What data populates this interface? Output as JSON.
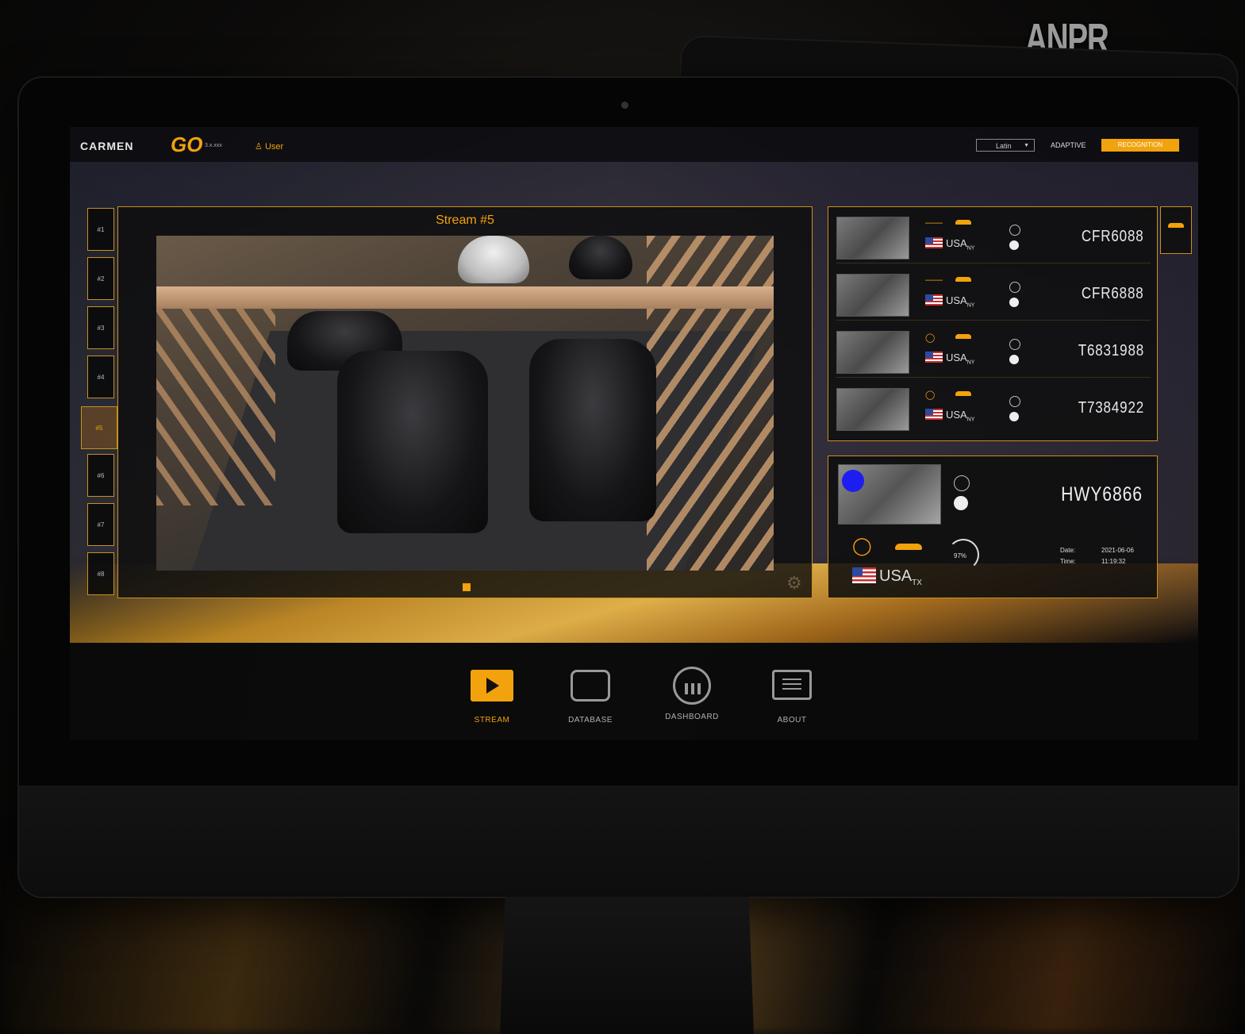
{
  "marketing": {
    "title": "ANPR RESULTS:"
  },
  "app": {
    "logo_text": "CARMEN",
    "logo_go": "GO",
    "logo_sub": "3.x.xxx",
    "user": "User",
    "language": "Latin",
    "adaptive_label": "ADAPTIVE",
    "recognition_button": "RECOGNITION"
  },
  "streams": {
    "tabs": [
      "#1",
      "#2",
      "#3",
      "#4",
      "#5",
      "#6",
      "#7",
      "#8"
    ],
    "active_index": 4,
    "title": "Stream #5"
  },
  "results": [
    {
      "plate": "CFR6088",
      "country": "USA",
      "state": "NY"
    },
    {
      "plate": "CFR6888",
      "country": "USA",
      "state": "NY"
    },
    {
      "plate": "T6831988",
      "country": "USA",
      "state": "NY"
    },
    {
      "plate": "T7384922",
      "country": "USA",
      "state": "NY"
    }
  ],
  "selected": {
    "plate": "HWY6866",
    "country": "USA",
    "state": "TX",
    "confidence": "97%",
    "date_label": "Date:",
    "date": "2021-06-06",
    "time_label": "Time:",
    "time": "11:19:32"
  },
  "nav": {
    "stream": "STREAM",
    "database": "DATABASE",
    "dashboard": "DASHBOARD",
    "about": "ABOUT"
  },
  "colors": {
    "accent": "#f2a20c",
    "selected_marker": "#1d1df2"
  },
  "icons": [
    "user-icon",
    "car-icon",
    "toyota-logo-icon",
    "usa-flag-icon",
    "gear-icon",
    "play-icon",
    "database-icon",
    "dashboard-icon",
    "about-icon"
  ]
}
